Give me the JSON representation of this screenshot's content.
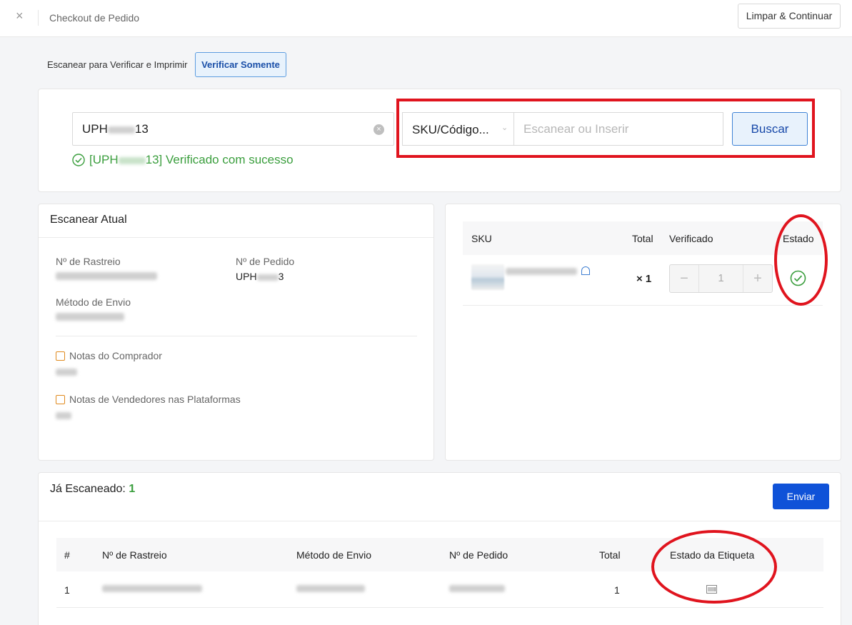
{
  "header": {
    "title": "Checkout de Pedido",
    "clear_button": "Limpar & Continuar"
  },
  "mode": {
    "scan_print_label": "Escanear para Verificar e Imprimir",
    "verify_only_label": "Verificar Somente"
  },
  "order_search": {
    "value_prefix": "UPH",
    "value_suffix": "13",
    "success_prefix": "[UPH",
    "success_suffix": "13] Verificado com sucesso"
  },
  "sku_search": {
    "type_selected": "SKU/Código...",
    "placeholder": "Escanear ou Inserir",
    "search_button": "Buscar"
  },
  "current_scan": {
    "title": "Escanear Atual",
    "tracking_label": "Nº de Rastreio",
    "order_label": "Nº de Pedido",
    "order_prefix": "UPH",
    "order_suffix": "3",
    "shipping_label": "Método de Envio",
    "buyer_notes_label": "Notas do Comprador",
    "seller_notes_label": "Notas de Vendedores nas Plataformas"
  },
  "sku_table": {
    "headers": {
      "sku": "SKU",
      "total": "Total",
      "verified": "Verificado",
      "status": "Estado"
    },
    "row": {
      "quantity": "× 1",
      "verified_count": "1"
    }
  },
  "scanned": {
    "label": "Já Escaneado:",
    "count": "1",
    "send_button": "Enviar",
    "headers": {
      "index": "#",
      "tracking": "Nº de Rastreio",
      "shipping": "Método de Envio",
      "order": "Nº de Pedido",
      "total": "Total",
      "label_status": "Estado da Etiqueta"
    },
    "rows": [
      {
        "index": "1",
        "total": "1"
      }
    ]
  },
  "colors": {
    "success_green": "#3a9e3d",
    "primary_blue": "#0f52d8",
    "highlight_red": "#e0141e"
  }
}
